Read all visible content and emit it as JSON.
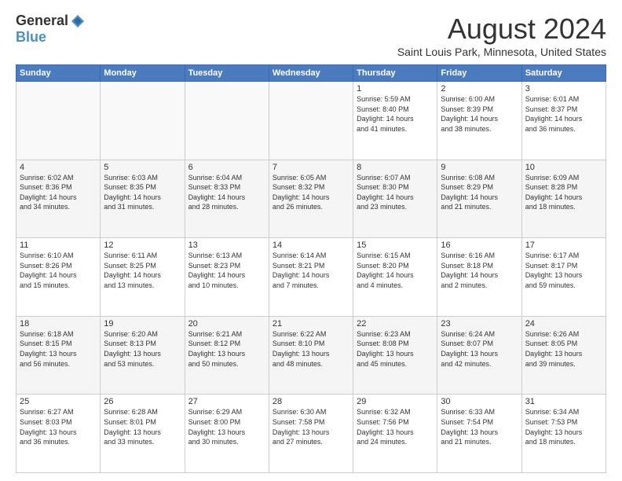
{
  "logo": {
    "general": "General",
    "blue": "Blue"
  },
  "title": {
    "month": "August 2024",
    "location": "Saint Louis Park, Minnesota, United States"
  },
  "calendar": {
    "headers": [
      "Sunday",
      "Monday",
      "Tuesday",
      "Wednesday",
      "Thursday",
      "Friday",
      "Saturday"
    ],
    "rows": [
      [
        {
          "day": "",
          "info": ""
        },
        {
          "day": "",
          "info": ""
        },
        {
          "day": "",
          "info": ""
        },
        {
          "day": "",
          "info": ""
        },
        {
          "day": "1",
          "info": "Sunrise: 5:59 AM\nSunset: 8:40 PM\nDaylight: 14 hours\nand 41 minutes."
        },
        {
          "day": "2",
          "info": "Sunrise: 6:00 AM\nSunset: 8:39 PM\nDaylight: 14 hours\nand 38 minutes."
        },
        {
          "day": "3",
          "info": "Sunrise: 6:01 AM\nSunset: 8:37 PM\nDaylight: 14 hours\nand 36 minutes."
        }
      ],
      [
        {
          "day": "4",
          "info": "Sunrise: 6:02 AM\nSunset: 8:36 PM\nDaylight: 14 hours\nand 34 minutes."
        },
        {
          "day": "5",
          "info": "Sunrise: 6:03 AM\nSunset: 8:35 PM\nDaylight: 14 hours\nand 31 minutes."
        },
        {
          "day": "6",
          "info": "Sunrise: 6:04 AM\nSunset: 8:33 PM\nDaylight: 14 hours\nand 28 minutes."
        },
        {
          "day": "7",
          "info": "Sunrise: 6:05 AM\nSunset: 8:32 PM\nDaylight: 14 hours\nand 26 minutes."
        },
        {
          "day": "8",
          "info": "Sunrise: 6:07 AM\nSunset: 8:30 PM\nDaylight: 14 hours\nand 23 minutes."
        },
        {
          "day": "9",
          "info": "Sunrise: 6:08 AM\nSunset: 8:29 PM\nDaylight: 14 hours\nand 21 minutes."
        },
        {
          "day": "10",
          "info": "Sunrise: 6:09 AM\nSunset: 8:28 PM\nDaylight: 14 hours\nand 18 minutes."
        }
      ],
      [
        {
          "day": "11",
          "info": "Sunrise: 6:10 AM\nSunset: 8:26 PM\nDaylight: 14 hours\nand 15 minutes."
        },
        {
          "day": "12",
          "info": "Sunrise: 6:11 AM\nSunset: 8:25 PM\nDaylight: 14 hours\nand 13 minutes."
        },
        {
          "day": "13",
          "info": "Sunrise: 6:13 AM\nSunset: 8:23 PM\nDaylight: 14 hours\nand 10 minutes."
        },
        {
          "day": "14",
          "info": "Sunrise: 6:14 AM\nSunset: 8:21 PM\nDaylight: 14 hours\nand 7 minutes."
        },
        {
          "day": "15",
          "info": "Sunrise: 6:15 AM\nSunset: 8:20 PM\nDaylight: 14 hours\nand 4 minutes."
        },
        {
          "day": "16",
          "info": "Sunrise: 6:16 AM\nSunset: 8:18 PM\nDaylight: 14 hours\nand 2 minutes."
        },
        {
          "day": "17",
          "info": "Sunrise: 6:17 AM\nSunset: 8:17 PM\nDaylight: 13 hours\nand 59 minutes."
        }
      ],
      [
        {
          "day": "18",
          "info": "Sunrise: 6:18 AM\nSunset: 8:15 PM\nDaylight: 13 hours\nand 56 minutes."
        },
        {
          "day": "19",
          "info": "Sunrise: 6:20 AM\nSunset: 8:13 PM\nDaylight: 13 hours\nand 53 minutes."
        },
        {
          "day": "20",
          "info": "Sunrise: 6:21 AM\nSunset: 8:12 PM\nDaylight: 13 hours\nand 50 minutes."
        },
        {
          "day": "21",
          "info": "Sunrise: 6:22 AM\nSunset: 8:10 PM\nDaylight: 13 hours\nand 48 minutes."
        },
        {
          "day": "22",
          "info": "Sunrise: 6:23 AM\nSunset: 8:08 PM\nDaylight: 13 hours\nand 45 minutes."
        },
        {
          "day": "23",
          "info": "Sunrise: 6:24 AM\nSunset: 8:07 PM\nDaylight: 13 hours\nand 42 minutes."
        },
        {
          "day": "24",
          "info": "Sunrise: 6:26 AM\nSunset: 8:05 PM\nDaylight: 13 hours\nand 39 minutes."
        }
      ],
      [
        {
          "day": "25",
          "info": "Sunrise: 6:27 AM\nSunset: 8:03 PM\nDaylight: 13 hours\nand 36 minutes."
        },
        {
          "day": "26",
          "info": "Sunrise: 6:28 AM\nSunset: 8:01 PM\nDaylight: 13 hours\nand 33 minutes."
        },
        {
          "day": "27",
          "info": "Sunrise: 6:29 AM\nSunset: 8:00 PM\nDaylight: 13 hours\nand 30 minutes."
        },
        {
          "day": "28",
          "info": "Sunrise: 6:30 AM\nSunset: 7:58 PM\nDaylight: 13 hours\nand 27 minutes."
        },
        {
          "day": "29",
          "info": "Sunrise: 6:32 AM\nSunset: 7:56 PM\nDaylight: 13 hours\nand 24 minutes."
        },
        {
          "day": "30",
          "info": "Sunrise: 6:33 AM\nSunset: 7:54 PM\nDaylight: 13 hours\nand 21 minutes."
        },
        {
          "day": "31",
          "info": "Sunrise: 6:34 AM\nSunset: 7:53 PM\nDaylight: 13 hours\nand 18 minutes."
        }
      ]
    ]
  }
}
